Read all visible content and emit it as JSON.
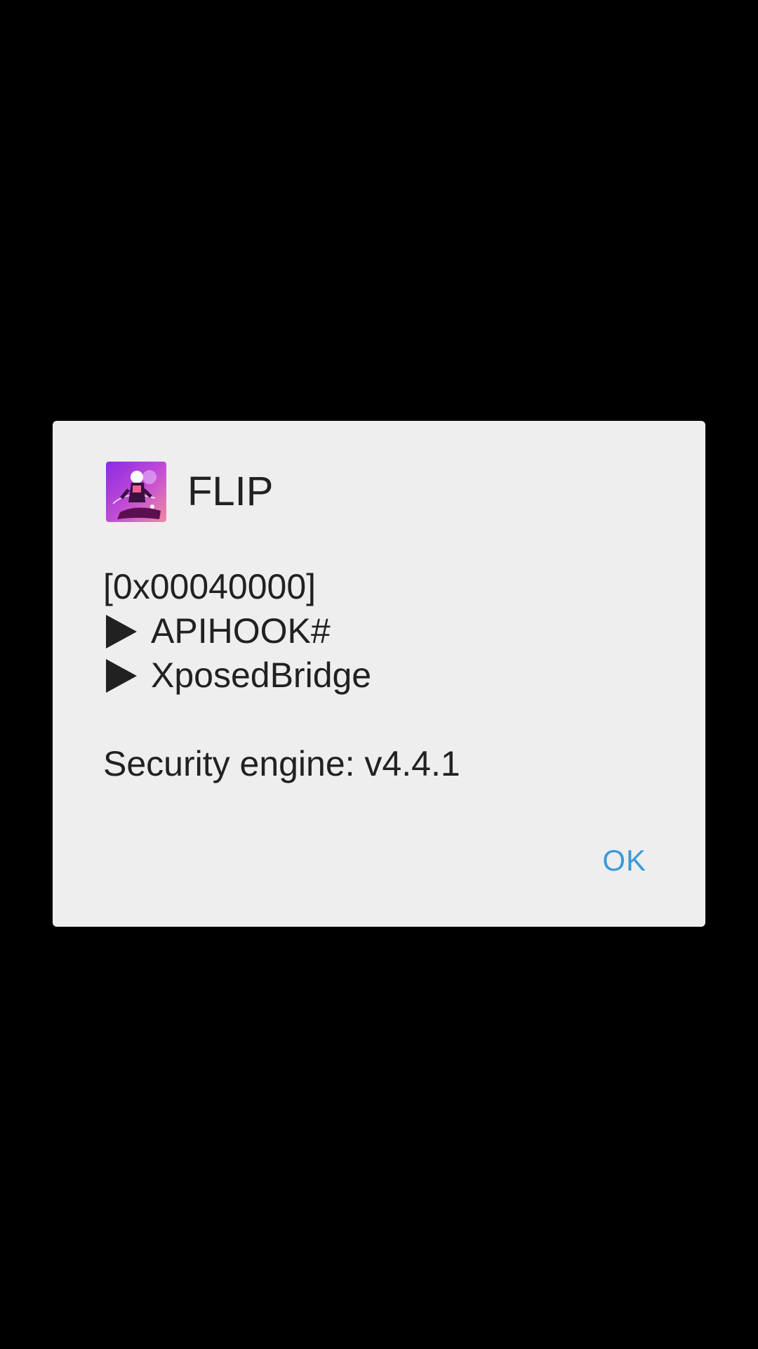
{
  "dialog": {
    "title": "FLIP",
    "app_icon": "flip-app-icon",
    "message_lines": [
      "[0x00040000]",
      "APIHOOK#",
      "XposedBridge"
    ],
    "bullet_icon": "play-triangle-icon",
    "engine_line": "Security engine: v4.4.1",
    "ok_label": "OK"
  },
  "colors": {
    "screen_background": "#000000",
    "dialog_background": "#eeeeee",
    "text": "#212121",
    "accent": "#3a9ad9"
  }
}
